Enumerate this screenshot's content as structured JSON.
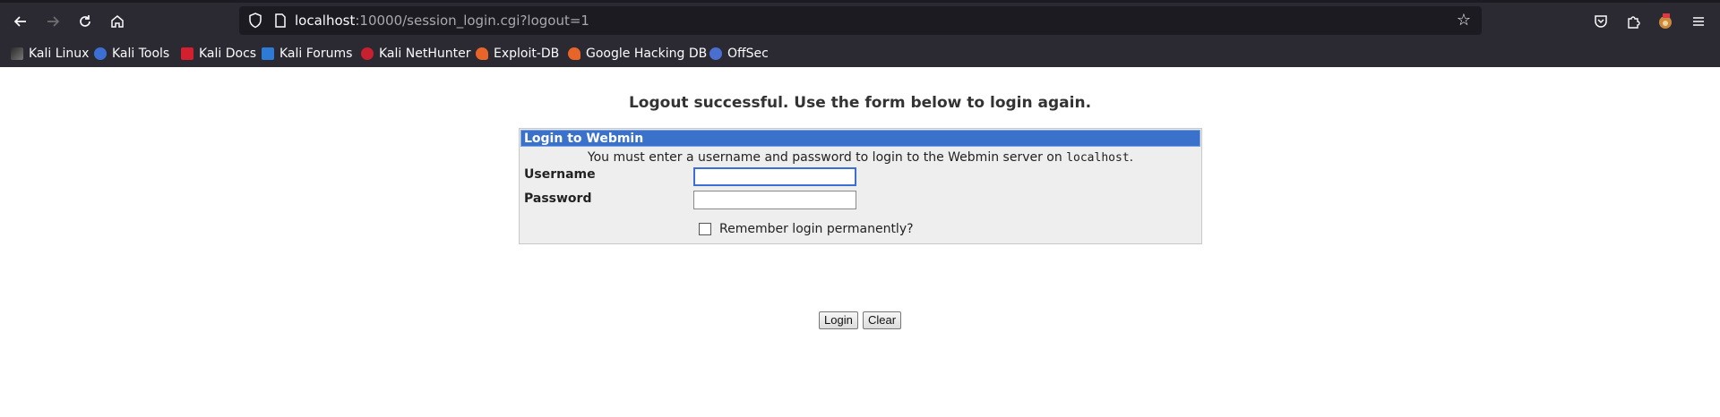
{
  "browser": {
    "url_host": "localhost",
    "url_path": ":10000/session_login.cgi?logout=1"
  },
  "bookmarks": [
    {
      "label": "Kali Linux",
      "icon": "kali-dragon-icon"
    },
    {
      "label": "Kali Tools",
      "icon": "kali-tools-icon"
    },
    {
      "label": "Kali Docs",
      "icon": "kali-docs-icon"
    },
    {
      "label": "Kali Forums",
      "icon": "kali-forums-icon"
    },
    {
      "label": "Kali NetHunter",
      "icon": "kali-nethunter-icon"
    },
    {
      "label": "Exploit-DB",
      "icon": "exploit-db-icon"
    },
    {
      "label": "Google Hacking DB",
      "icon": "ghdb-icon"
    },
    {
      "label": "OffSec",
      "icon": "offsec-icon"
    }
  ],
  "page": {
    "logout_message": "Logout successful. Use the form below to login again.",
    "form_title": "Login to Webmin",
    "intro_prefix": "You must enter a username and password to login to the Webmin server on ",
    "intro_host": "localhost",
    "intro_suffix": ".",
    "username_label": "Username",
    "password_label": "Password",
    "username_value": "",
    "password_value": "",
    "remember_label": "Remember login permanently?",
    "login_button": "Login",
    "clear_button": "Clear"
  }
}
